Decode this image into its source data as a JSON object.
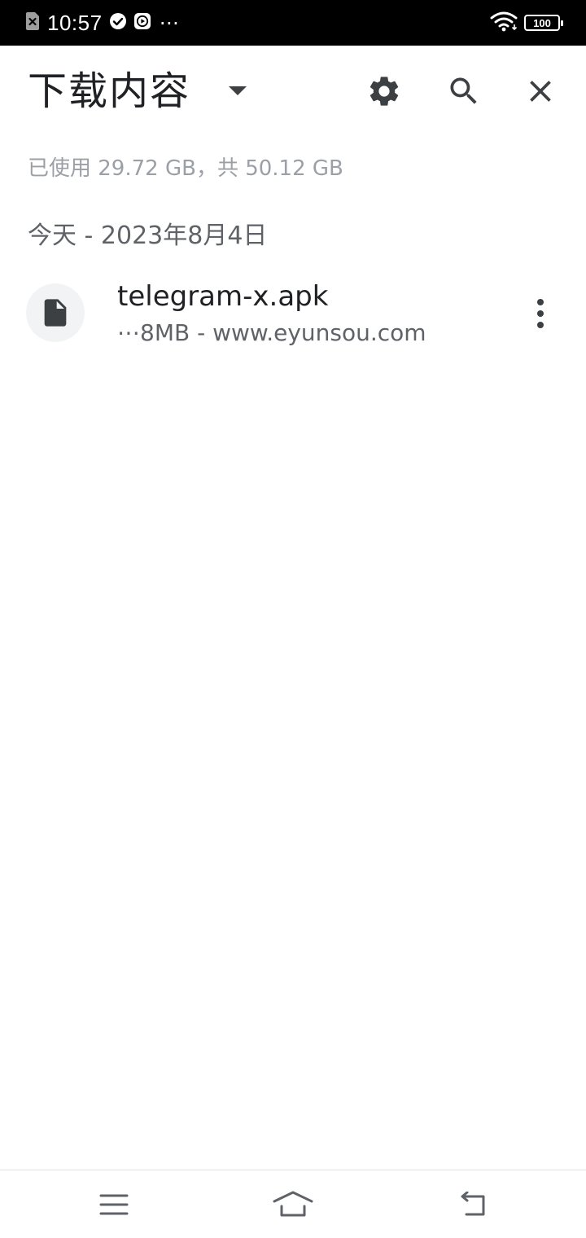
{
  "status_bar": {
    "time": "10:57",
    "more_dots": "⋯",
    "battery": "100"
  },
  "header": {
    "title": "下载内容"
  },
  "storage": {
    "text": "已使用 29.72 GB，共 50.12 GB"
  },
  "section": {
    "date_label": "今天 - 2023年8月4日"
  },
  "downloads": [
    {
      "name": "telegram-x.apk",
      "meta": "⋯8MB - www.eyunsou.com",
      "icon": "file-icon"
    }
  ],
  "icons": {
    "title_dropdown": "dropdown-arrow-icon",
    "settings": "gear-icon",
    "search": "search-icon",
    "close": "close-icon",
    "item_more": "more-vertical-icon",
    "nav_menu": "menu-icon",
    "nav_home": "home-icon",
    "nav_back": "back-icon"
  },
  "colors": {
    "status_bar_bg": "#000000",
    "primary_text": "#202124",
    "secondary_text": "#5f6368",
    "muted_text": "#9aa0a6",
    "icon_dark": "#3c4043",
    "file_circle_bg": "#f1f3f4"
  }
}
